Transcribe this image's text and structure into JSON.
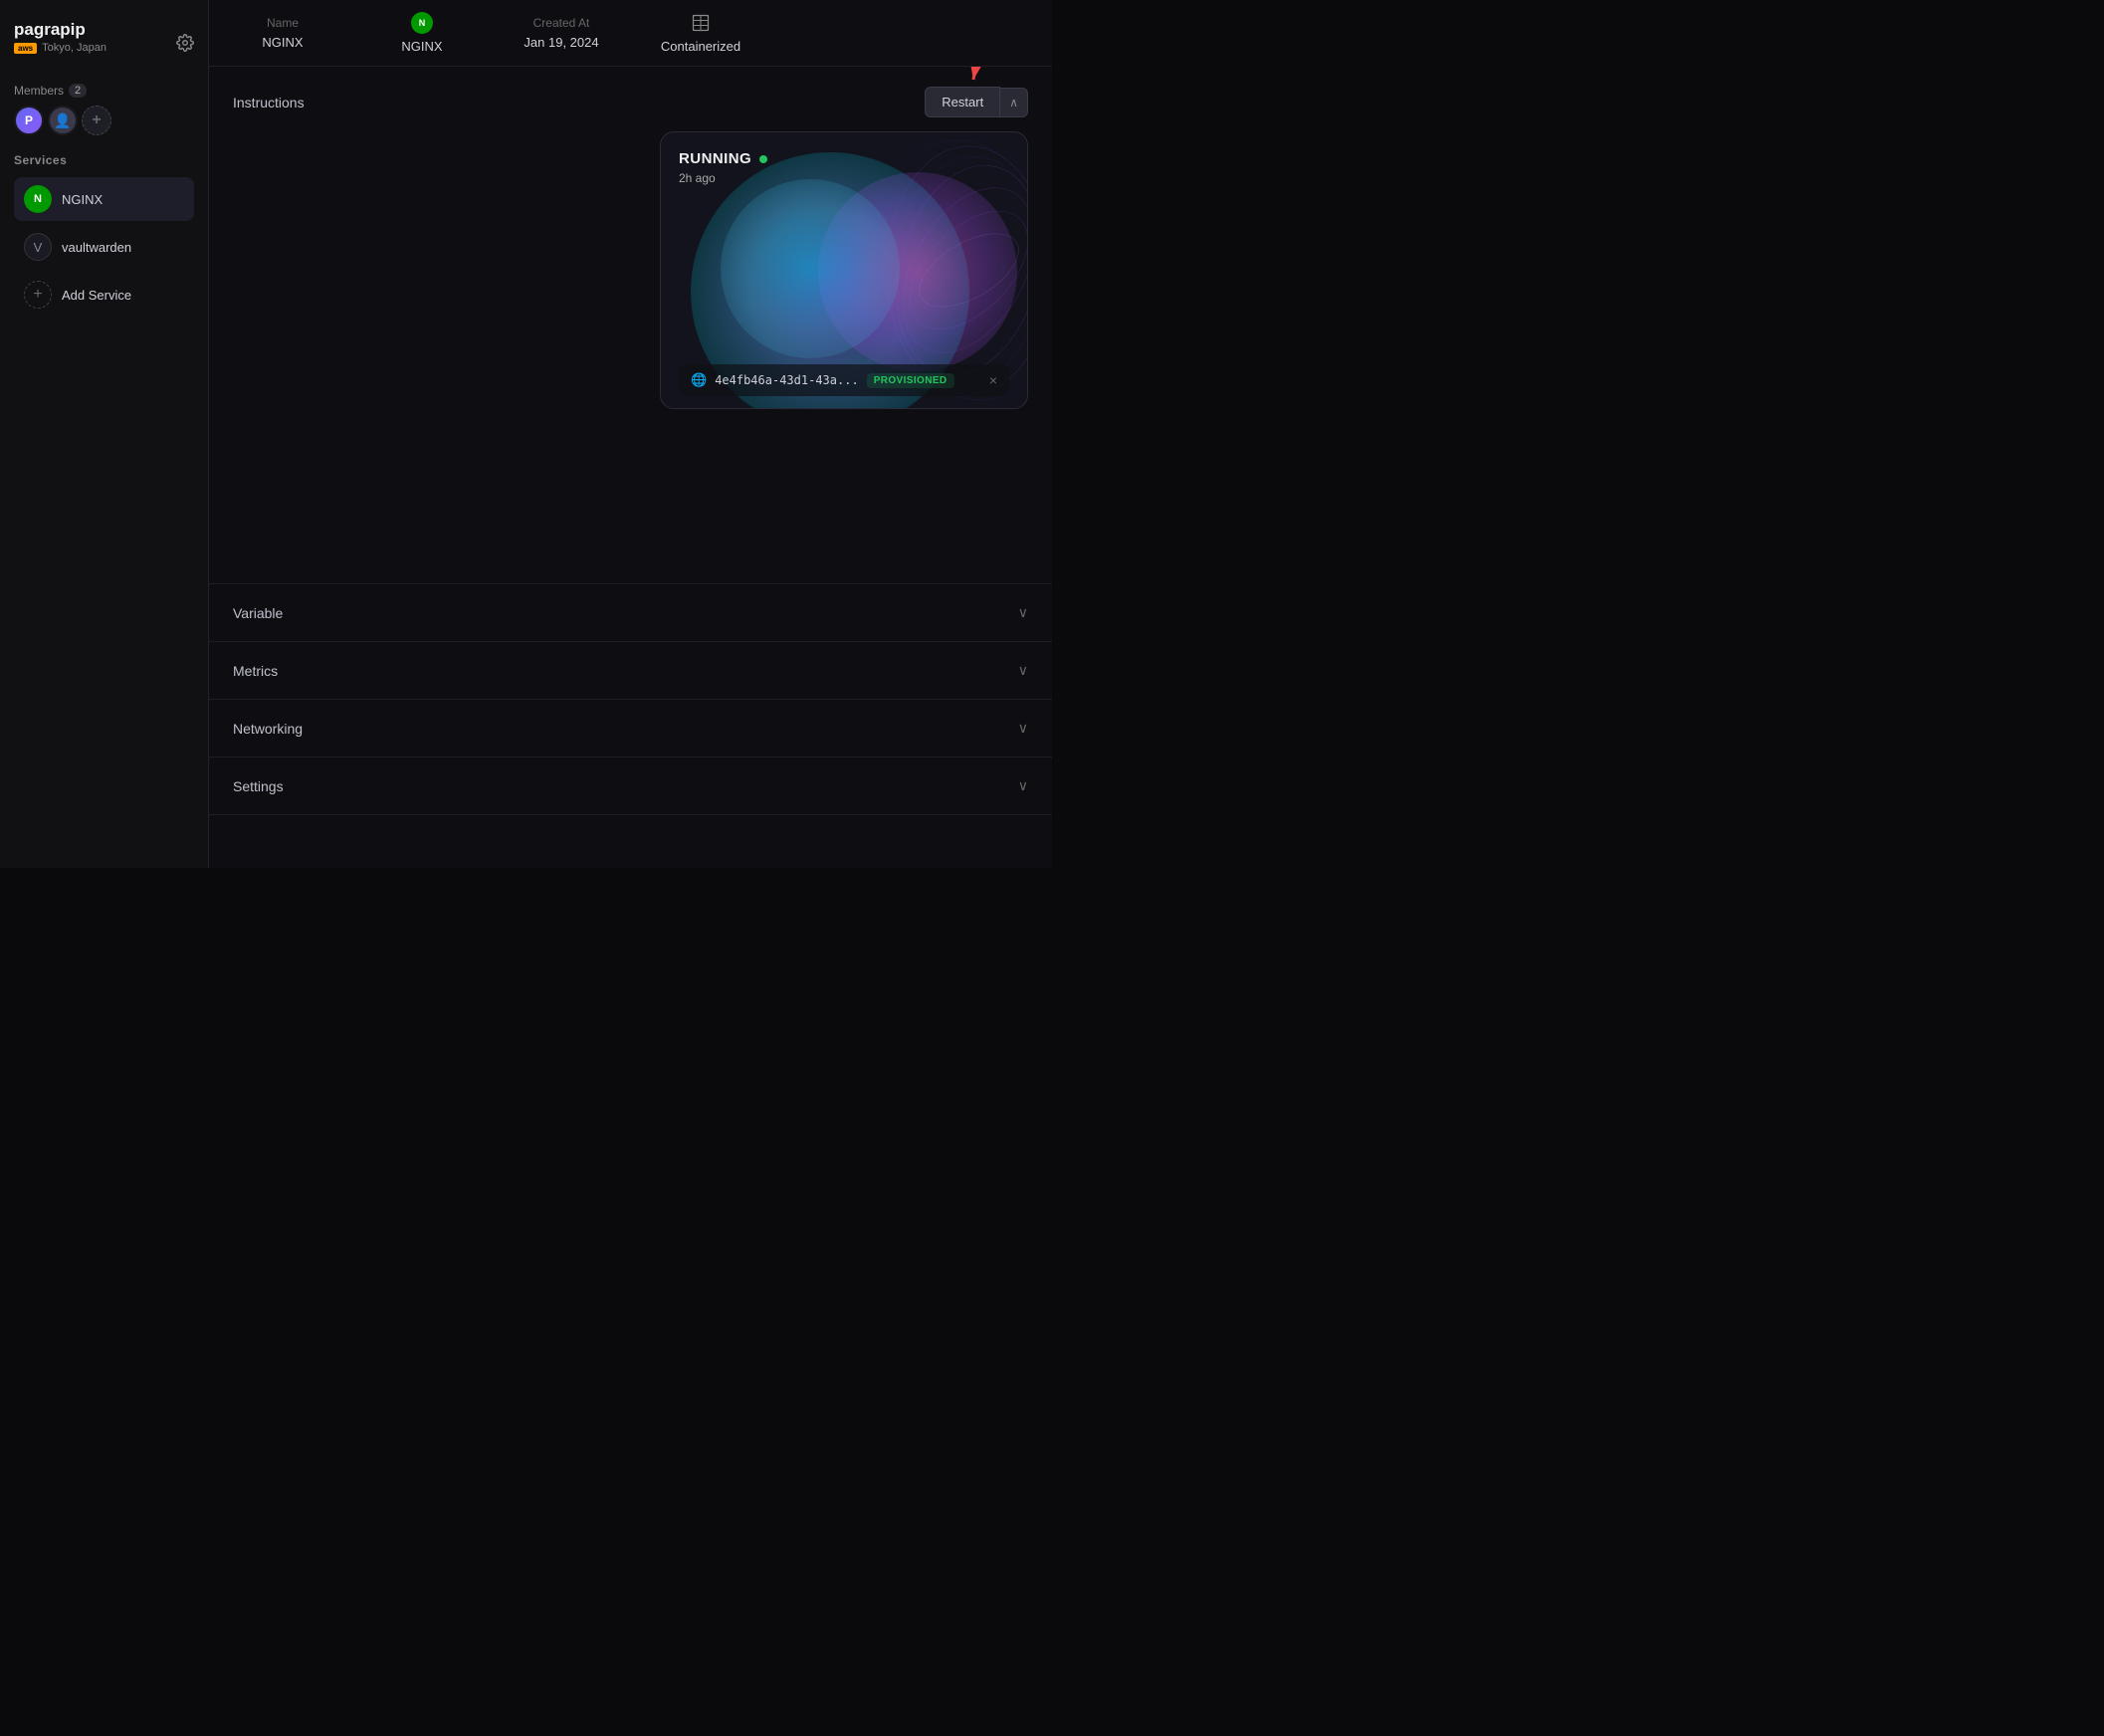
{
  "sidebar": {
    "project_name": "pagrapip",
    "region_badge": "aws",
    "region_text": "Tokyo, Japan",
    "settings_icon": "⚙",
    "members_label": "Members",
    "members_count": "2",
    "services_label": "Services",
    "services": [
      {
        "id": "nginx",
        "icon_letter": "N",
        "name": "NGINX",
        "active": true
      },
      {
        "id": "vaultwarden",
        "icon_symbol": "V",
        "name": "vaultwarden",
        "active": false
      }
    ],
    "add_service_label": "Add Service"
  },
  "header": {
    "col1_label": "Name",
    "col1_value": "NGINX",
    "col2_label": "",
    "col2_value": "NGINX",
    "col3_label": "Created At",
    "col3_value": "Jan 19, 2024",
    "col4_label": "Containerized",
    "col4_icon": "container"
  },
  "instructions": {
    "title": "Instructions",
    "restart_label": "Restart",
    "status": {
      "state": "RUNNING",
      "time": "2h ago",
      "provision_id": "4e4fb46a-43d1-43a...",
      "provision_status": "PROVISIONED"
    }
  },
  "sections": [
    {
      "id": "variable",
      "label": "Variable"
    },
    {
      "id": "metrics",
      "label": "Metrics"
    },
    {
      "id": "networking",
      "label": "Networking"
    },
    {
      "id": "settings",
      "label": "Settings"
    }
  ]
}
